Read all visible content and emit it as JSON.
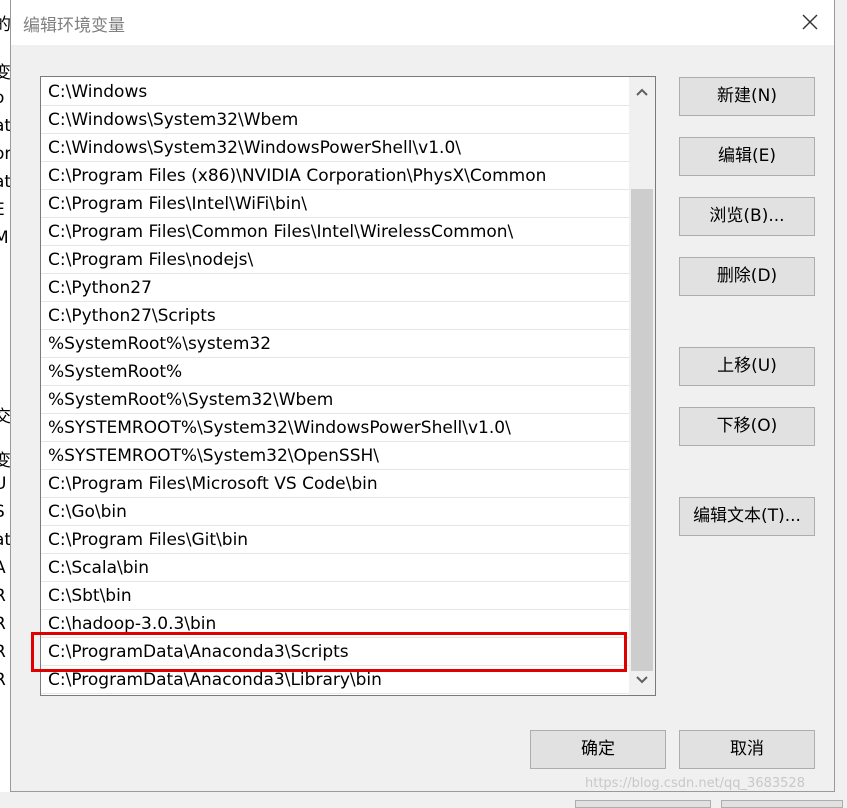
{
  "dialog": {
    "title": "编辑环境变量"
  },
  "background": {
    "left_fragments": [
      "的",
      "变",
      "o",
      "at",
      "on",
      "at",
      "E",
      "M",
      "交",
      "变",
      "U",
      "S",
      "at",
      "A",
      "R",
      "R",
      "R",
      "R"
    ]
  },
  "path_list": [
    "C:\\Windows",
    "C:\\Windows\\System32\\Wbem",
    "C:\\Windows\\System32\\WindowsPowerShell\\v1.0\\",
    "C:\\Program Files (x86)\\NVIDIA Corporation\\PhysX\\Common",
    "C:\\Program Files\\Intel\\WiFi\\bin\\",
    "C:\\Program Files\\Common Files\\Intel\\WirelessCommon\\",
    "C:\\Program Files\\nodejs\\",
    "C:\\Python27",
    "C:\\Python27\\Scripts",
    "%SystemRoot%\\system32",
    "%SystemRoot%",
    "%SystemRoot%\\System32\\Wbem",
    "%SYSTEMROOT%\\System32\\WindowsPowerShell\\v1.0\\",
    "%SYSTEMROOT%\\System32\\OpenSSH\\",
    "C:\\Program Files\\Microsoft VS Code\\bin",
    "C:\\Go\\bin",
    "C:\\Program Files\\Git\\bin",
    "C:\\Scala\\bin",
    "C:\\Sbt\\bin",
    "C:\\hadoop-3.0.3\\bin",
    "C:\\ProgramData\\Anaconda3\\Scripts",
    "C:\\ProgramData\\Anaconda3\\Library\\bin"
  ],
  "highlighted_item": "C:\\ProgramData\\Anaconda3\\Scripts",
  "buttons": {
    "new": "新建(N)",
    "edit": "编辑(E)",
    "browse": "浏览(B)...",
    "delete": "删除(D)",
    "move_up": "上移(U)",
    "move_down": "下移(O)",
    "edit_text": "编辑文本(T)...",
    "ok": "确定",
    "cancel": "取消"
  },
  "icons": {
    "close": "close-icon",
    "scroll_up": "chevron-up-icon",
    "scroll_down": "chevron-down-icon"
  },
  "colors": {
    "highlight_border": "#e00000",
    "button_bg": "#e1e1e1",
    "title_text": "#808080"
  },
  "watermark": "https://blog.csdn.net/qq_3683528"
}
